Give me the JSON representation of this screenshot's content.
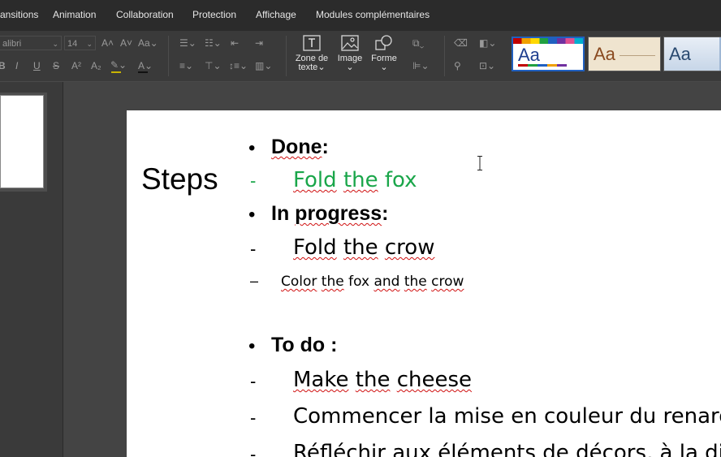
{
  "menu": {
    "items": [
      "ansitions",
      "Animation",
      "Collaboration",
      "Protection",
      "Affichage",
      "Modules complémentaires"
    ]
  },
  "toolbar": {
    "font_name": "alibri",
    "font_size": "14",
    "buttons": {
      "textbox": [
        "Zone de",
        "texte"
      ],
      "image": "Image",
      "shape": "Forme"
    },
    "theme_label": "Aa"
  },
  "slide": {
    "title": "Steps",
    "bullets": {
      "b1": "•",
      "d1": "-",
      "b2": "•",
      "d2": "-",
      "d3": "–",
      "b3": "•",
      "d4": "-",
      "d5": "-",
      "d6": "-"
    },
    "done_word": "Done",
    "done_colon": ":",
    "done_item_w1": "Fold",
    "done_item_w2": "the",
    "done_item_w3": "fox",
    "in_word1": "In",
    "in_word2": "progress",
    "in_colon": ":",
    "prog1_w1": "Fold",
    "prog1_w2": "the",
    "prog1_w3": "crow",
    "prog2_w1": "Color",
    "prog2_w2": "the",
    "prog2_w3": "fox",
    "prog2_w4": "and",
    "prog2_w5": "the",
    "prog2_w6": "crow",
    "todo": "To do :",
    "todo1_w1": "Make",
    "todo1_w2": "the",
    "todo1_w3": "cheese",
    "todo2": "Commencer la mise en couleur du renard e",
    "todo3_w1": "Réfléchir",
    "todo3_w2": "aux éléments de décors, à la disp"
  },
  "colors": {
    "done_green": "#1aa64a",
    "spell_red": "#d01010"
  }
}
